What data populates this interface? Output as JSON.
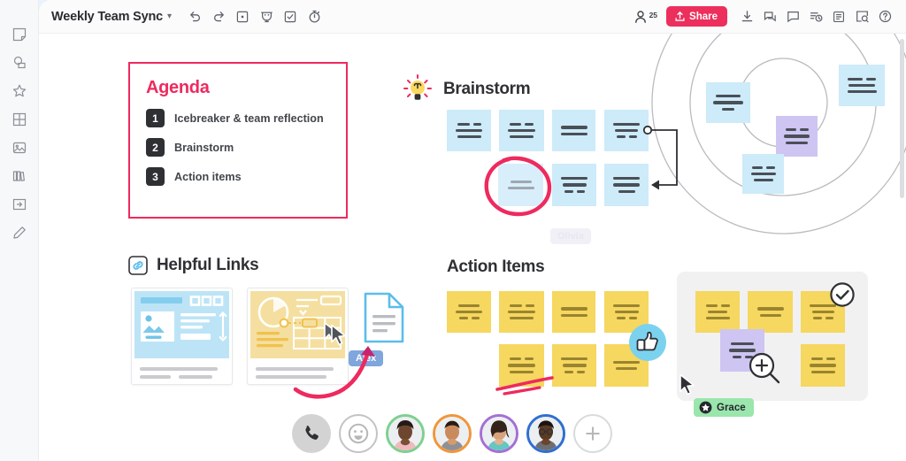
{
  "app": {
    "title": "Weekly Team Sync",
    "title_chevron": "chevron-down-icon"
  },
  "toolbar": {
    "icons": [
      "undo-icon",
      "redo-icon",
      "frame-icon",
      "presentation-icon",
      "vote-icon",
      "timer-icon"
    ],
    "people_count": "25",
    "share_label": "Share",
    "right_icons": [
      "download-icon",
      "comments-icon",
      "chat-icon",
      "history-icon",
      "list-icon",
      "search-board-icon",
      "help-icon"
    ]
  },
  "sidebar": {
    "items": [
      {
        "icon": "sticky-note-icon",
        "label": "Sticky note"
      },
      {
        "icon": "shapes-comment-icon",
        "label": "Shapes"
      },
      {
        "icon": "star-icon",
        "label": "Templates"
      },
      {
        "icon": "grid-table-icon",
        "label": "Table"
      },
      {
        "icon": "image-icon",
        "label": "Image"
      },
      {
        "icon": "library-icon",
        "label": "Library"
      },
      {
        "icon": "frame-import-icon",
        "label": "Frame"
      },
      {
        "icon": "pen-icon",
        "label": "Pen"
      }
    ]
  },
  "agenda": {
    "heading": "Agenda",
    "items": [
      {
        "number": "1",
        "label": "Icebreaker & team reflection"
      },
      {
        "number": "2",
        "label": "Brainstorm"
      },
      {
        "number": "3",
        "label": "Action items"
      }
    ],
    "border_color": "#ee2a5e"
  },
  "sections": {
    "brainstorm": {
      "title": "Brainstorm",
      "icon": "lightbulb-icon"
    },
    "helpful_links": {
      "title": "Helpful Links",
      "icon": "link-icon"
    },
    "action_items": {
      "title": "Action Items"
    }
  },
  "cursors": [
    {
      "name": "Alex",
      "color": "#7fa6dd"
    },
    {
      "name": "Olivia",
      "color": "#f0eef6"
    },
    {
      "name": "Grace",
      "color": "#9ae6ad",
      "icon": "star-badge-icon"
    }
  ],
  "badges": {
    "thumbs_up": "thumbs-up-icon",
    "check": "check-circle-icon",
    "zoom_in": "zoom-in-icon"
  },
  "dock": {
    "phone": "phone-icon",
    "emoji": "smiley-icon",
    "add": "add-participant-icon",
    "participants": [
      {
        "ring": "#7ed08f",
        "skin": "#6e4630",
        "hair": "#241a16",
        "shirt": "#f0b9bd"
      },
      {
        "ring": "#f0963c",
        "skin": "#c98a5e",
        "hair": "#2a1c12",
        "shirt": "#8e9095"
      },
      {
        "ring": "#a56fd4",
        "skin": "#d6a37c",
        "hair": "#33231a",
        "shirt": "#63c7c2"
      },
      {
        "ring": "#2f6fd0",
        "skin": "#5c3a24",
        "hair": "#1b1411",
        "shirt": "#6d6f74"
      }
    ]
  },
  "colors": {
    "accent_pink": "#ee2a5e",
    "sticky_blue": "#cdebf9",
    "sticky_yellow": "#f6d75f",
    "sticky_purple": "#cec5f2",
    "ink": "#2e3034"
  }
}
